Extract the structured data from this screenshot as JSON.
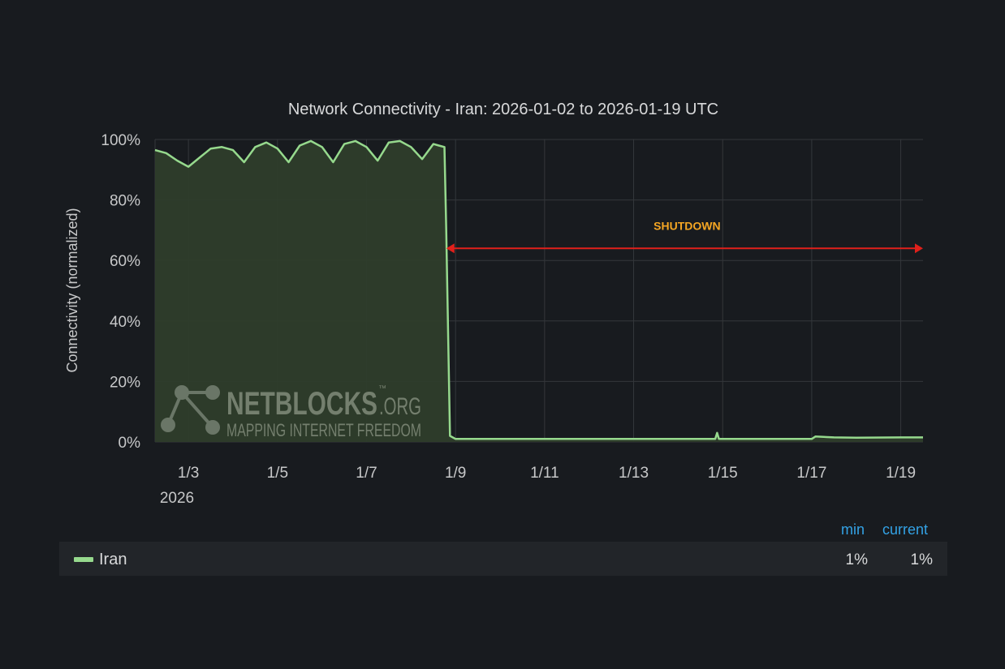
{
  "chart_data": {
    "type": "area",
    "title": "Network Connectivity - Iran: 2026-01-02 to 2026-01-19 UTC",
    "ylabel": "Connectivity (normalized)",
    "xlabel": "",
    "x_range": [
      "2026-01-02T06:00",
      "2026-01-19T12:00"
    ],
    "ylim": [
      0,
      100
    ],
    "y_ticks": [
      "0%",
      "20%",
      "40%",
      "60%",
      "80%",
      "100%"
    ],
    "x_ticks": [
      {
        "date": "2026-01-03",
        "label": "1/3"
      },
      {
        "date": "2026-01-05",
        "label": "1/5"
      },
      {
        "date": "2026-01-07",
        "label": "1/7"
      },
      {
        "date": "2026-01-09",
        "label": "1/9"
      },
      {
        "date": "2026-01-11",
        "label": "1/11"
      },
      {
        "date": "2026-01-13",
        "label": "1/13"
      },
      {
        "date": "2026-01-15",
        "label": "1/15"
      },
      {
        "date": "2026-01-17",
        "label": "1/17"
      },
      {
        "date": "2026-01-19",
        "label": "1/19"
      }
    ],
    "x_year_label": "2026",
    "grid": true,
    "series": [
      {
        "name": "Iran",
        "color": "#96d98d",
        "points": [
          [
            "2026-01-02T06:00",
            96.5
          ],
          [
            "2026-01-02T12:00",
            95.5
          ],
          [
            "2026-01-02T18:00",
            93
          ],
          [
            "2026-01-03T00:00",
            91
          ],
          [
            "2026-01-03T06:00",
            94
          ],
          [
            "2026-01-03T12:00",
            97
          ],
          [
            "2026-01-03T18:00",
            97.5
          ],
          [
            "2026-01-04T00:00",
            96.5
          ],
          [
            "2026-01-04T06:00",
            92.5
          ],
          [
            "2026-01-04T12:00",
            97.5
          ],
          [
            "2026-01-04T18:00",
            99
          ],
          [
            "2026-01-05T00:00",
            97
          ],
          [
            "2026-01-05T06:00",
            92.5
          ],
          [
            "2026-01-05T12:00",
            98
          ],
          [
            "2026-01-05T18:00",
            99.5
          ],
          [
            "2026-01-06T00:00",
            97.5
          ],
          [
            "2026-01-06T06:00",
            92.5
          ],
          [
            "2026-01-06T12:00",
            98.5
          ],
          [
            "2026-01-06T18:00",
            99.5
          ],
          [
            "2026-01-07T00:00",
            97.5
          ],
          [
            "2026-01-07T06:00",
            93
          ],
          [
            "2026-01-07T12:00",
            99
          ],
          [
            "2026-01-07T18:00",
            99.5
          ],
          [
            "2026-01-08T00:00",
            97.5
          ],
          [
            "2026-01-08T06:00",
            93.5
          ],
          [
            "2026-01-08T12:00",
            98.5
          ],
          [
            "2026-01-08T15:00",
            98
          ],
          [
            "2026-01-08T18:00",
            97.5
          ],
          [
            "2026-01-08T19:00",
            70
          ],
          [
            "2026-01-08T21:00",
            2
          ],
          [
            "2026-01-09T00:00",
            1
          ],
          [
            "2026-01-11T00:00",
            1
          ],
          [
            "2026-01-13T00:00",
            1
          ],
          [
            "2026-01-14T20:00",
            1
          ],
          [
            "2026-01-14T21:00",
            3
          ],
          [
            "2026-01-14T22:00",
            1
          ],
          [
            "2026-01-16T12:00",
            1
          ],
          [
            "2026-01-17T00:00",
            1
          ],
          [
            "2026-01-17T02:00",
            1.8
          ],
          [
            "2026-01-17T12:00",
            1.5
          ],
          [
            "2026-01-18T00:00",
            1.4
          ],
          [
            "2026-01-19T00:00",
            1.5
          ],
          [
            "2026-01-19T12:00",
            1.5
          ]
        ]
      }
    ],
    "annotation": {
      "label": "SHUTDOWN",
      "label_color": "#f5a623",
      "arrow_color": "#e0201b",
      "from": "2026-01-08T19:00",
      "to": "2026-01-19T12:00",
      "y": 64
    },
    "watermark": {
      "name": "NETBLOCKS",
      "domain": ".ORG",
      "tm": "™",
      "tagline": "MAPPING INTERNET FREEDOM"
    }
  },
  "legend": {
    "headers": {
      "min": "min",
      "current": "current"
    },
    "rows": [
      {
        "name": "Iran",
        "min": "1%",
        "current": "1%"
      }
    ]
  }
}
